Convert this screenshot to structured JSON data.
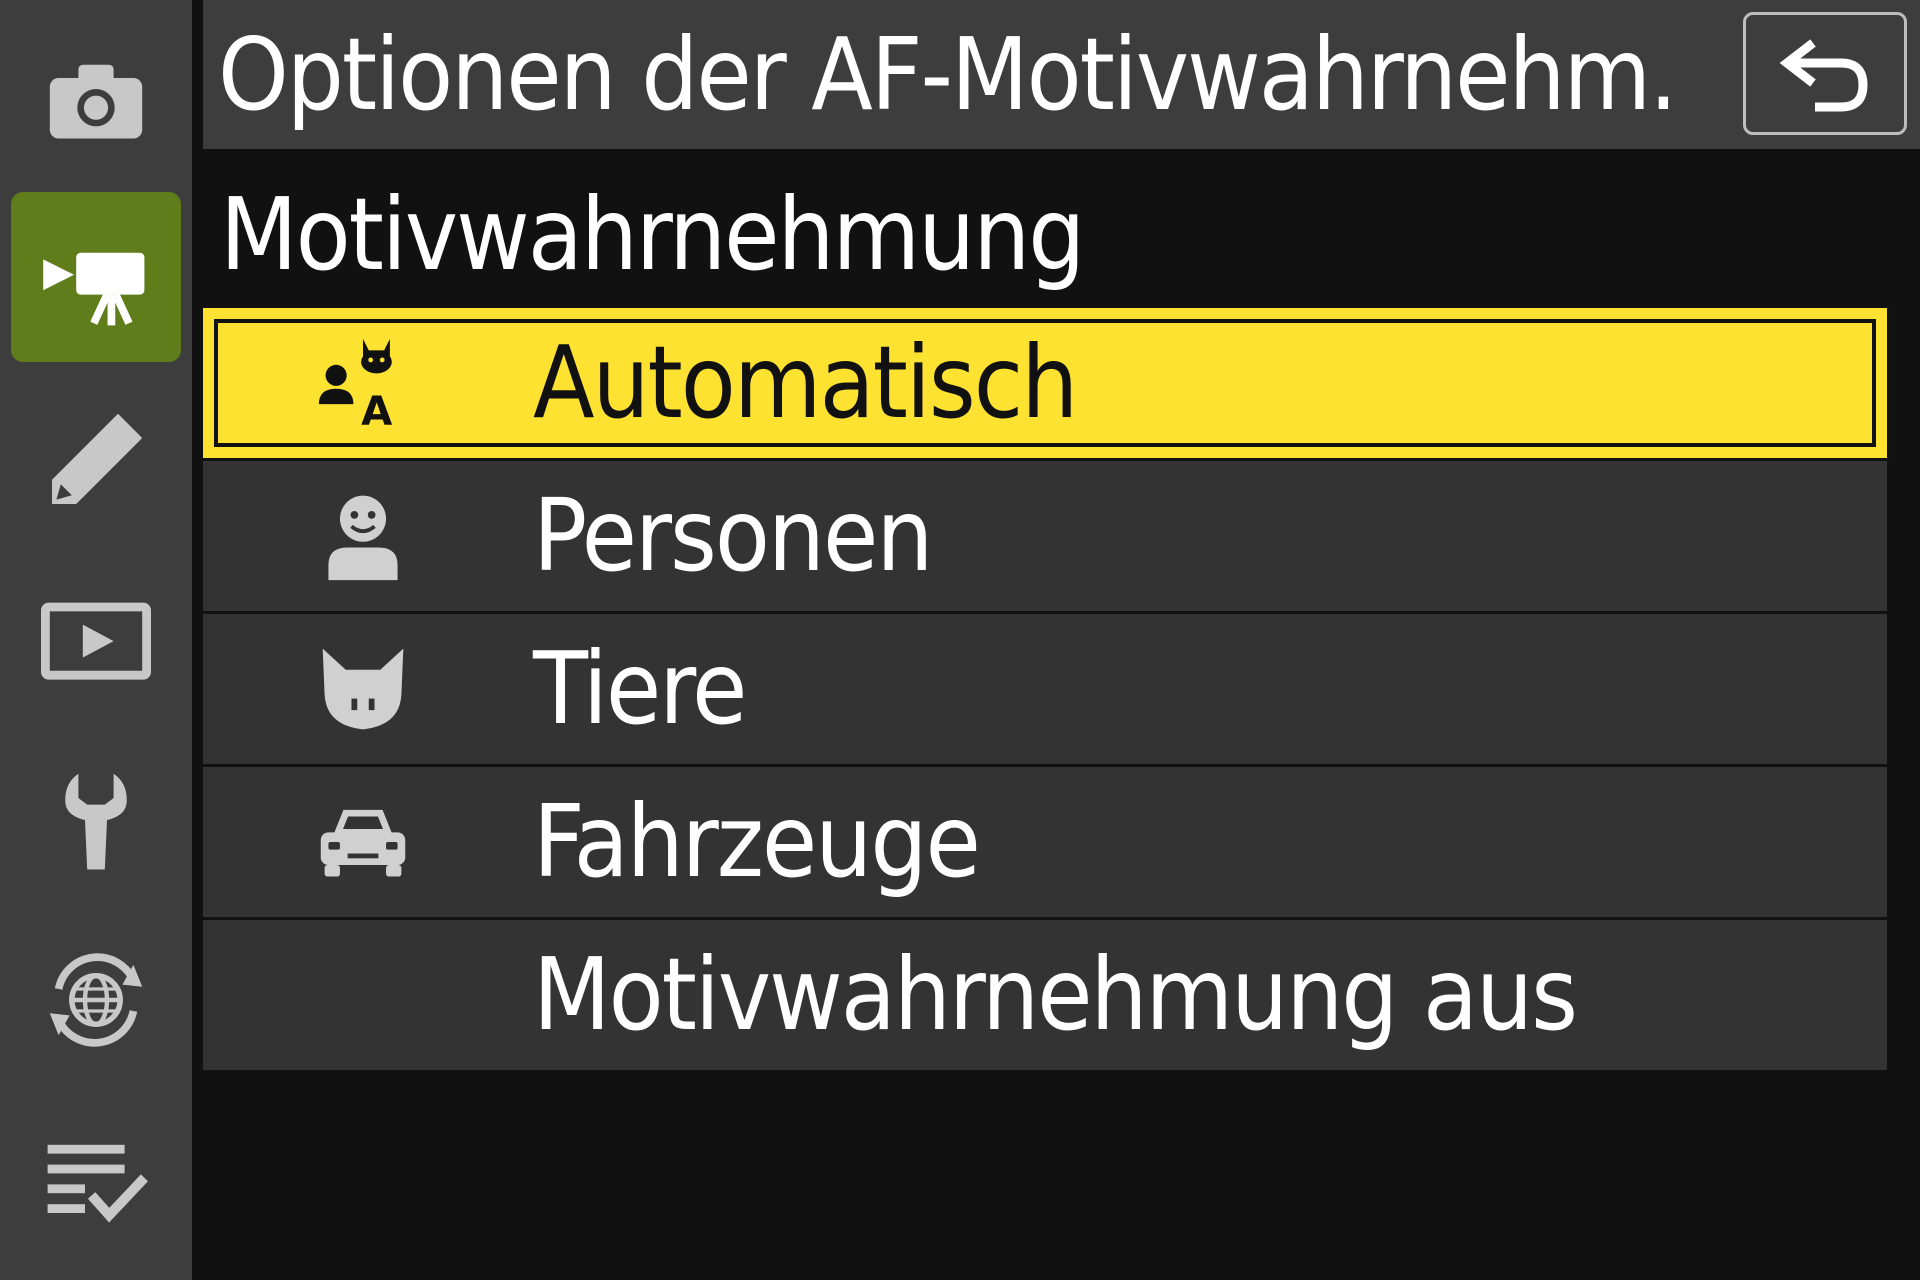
{
  "header": {
    "title": "Optionen der AF-Motivwahrnehm.",
    "back_icon": "back-return-icon"
  },
  "sidebar": {
    "items": [
      {
        "icon": "photo-shooting-camera-icon",
        "active": false
      },
      {
        "icon": "movie-recording-icon",
        "active": true
      },
      {
        "icon": "custom-settings-pencil-icon",
        "active": false
      },
      {
        "icon": "playback-icon",
        "active": false
      },
      {
        "icon": "setup-wrench-icon",
        "active": false
      },
      {
        "icon": "network-globe-icon",
        "active": false
      },
      {
        "icon": "my-menu-checklist-icon",
        "active": false
      }
    ],
    "active_color": "#5f7d1a"
  },
  "section": {
    "title": "Motivwahrnehmung"
  },
  "options": [
    {
      "label": "Automatisch",
      "icon": "auto-subject-detection-icon",
      "selected": true
    },
    {
      "label": "Personen",
      "icon": "person-icon",
      "selected": false
    },
    {
      "label": "Tiere",
      "icon": "animal-cat-icon",
      "selected": false
    },
    {
      "label": "Fahrzeuge",
      "icon": "vehicle-car-icon",
      "selected": false
    },
    {
      "label": "Motivwahrnehmung aus",
      "icon": "",
      "selected": false
    }
  ],
  "colors": {
    "highlight": "#fde232",
    "background": "#111111",
    "panel": "#3d3d3d",
    "row": "#333333"
  }
}
